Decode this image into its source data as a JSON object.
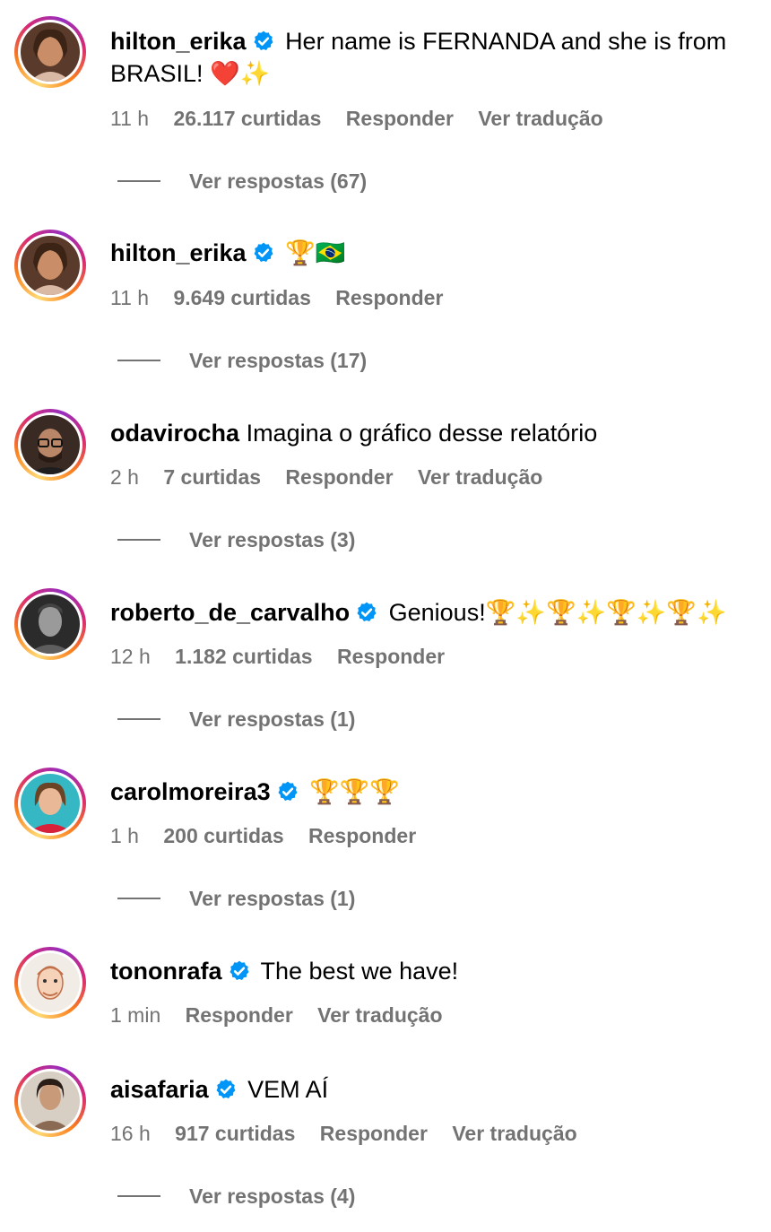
{
  "colors": {
    "secondary_text": "#737373",
    "verified_blue": "#0095f6",
    "heart_red": "#e11d2e",
    "trophy_gold": "#f2b01e"
  },
  "comments": [
    {
      "username": "hilton_erika",
      "verified": true,
      "text_line1": "Her name is FERNANDA and she is from",
      "text_line2": "BRASIL! ",
      "emoji": "❤️✨",
      "time": "11 h",
      "likes": "26.117 curtidas",
      "reply": "Responder",
      "translate": "Ver tradução",
      "view_replies": "Ver respostas (67)"
    },
    {
      "username": "hilton_erika",
      "verified": true,
      "text": "",
      "emoji": "🏆🇧🇷",
      "time": "11 h",
      "likes": "9.649 curtidas",
      "reply": "Responder",
      "view_replies": "Ver respostas (17)"
    },
    {
      "username": "odavirocha",
      "verified": false,
      "text": "Imagina o gráfico desse relatório",
      "time": "2 h",
      "likes": "7 curtidas",
      "reply": "Responder",
      "translate": "Ver tradução",
      "view_replies": "Ver respostas (3)"
    },
    {
      "username": "roberto_de_carvalho",
      "verified": true,
      "text": "Genious!",
      "emoji": "🏆✨🏆✨🏆✨🏆✨",
      "time": "12 h",
      "likes": "1.182 curtidas",
      "reply": "Responder",
      "view_replies": "Ver respostas (1)"
    },
    {
      "username": "carolmoreira3",
      "verified": true,
      "text": "",
      "emoji": "🏆🏆🏆",
      "time": "1 h",
      "likes": "200 curtidas",
      "reply": "Responder",
      "view_replies": "Ver respostas (1)"
    },
    {
      "username": "tononrafa",
      "verified": true,
      "text": "The best we have!",
      "time": "1 min",
      "reply": "Responder",
      "translate": "Ver tradução"
    },
    {
      "username": "aisafaria",
      "verified": true,
      "text": "VEM AÍ",
      "time": "16 h",
      "likes": "917 curtidas",
      "reply": "Responder",
      "translate": "Ver tradução",
      "view_replies": "Ver respostas (4)"
    }
  ]
}
